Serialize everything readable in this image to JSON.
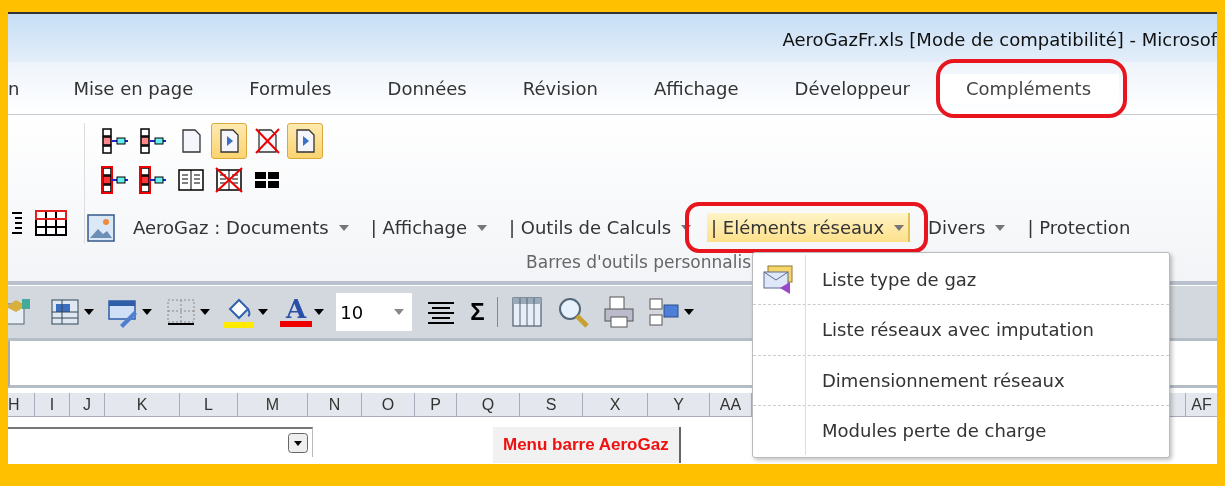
{
  "window": {
    "title": "AeroGazFr.xls  [Mode de compatibilité]  -  Microsof"
  },
  "tabs": [
    {
      "label": "n",
      "selected": false,
      "annotated": false
    },
    {
      "label": "Mise en page",
      "selected": false,
      "annotated": false
    },
    {
      "label": "Formules",
      "selected": false,
      "annotated": false
    },
    {
      "label": "Données",
      "selected": false,
      "annotated": false
    },
    {
      "label": "Révision",
      "selected": false,
      "annotated": false
    },
    {
      "label": "Affichage",
      "selected": false,
      "annotated": false
    },
    {
      "label": "Développeur",
      "selected": false,
      "annotated": false
    },
    {
      "label": "Compléments",
      "selected": true,
      "annotated": true
    }
  ],
  "ribbon": {
    "icon_rows": [
      [
        {
          "kind": "row-left",
          "pressed": false
        },
        {
          "kind": "row-right",
          "pressed": false
        },
        {
          "kind": "page",
          "pressed": false
        },
        {
          "kind": "page-play",
          "pressed": true
        },
        {
          "kind": "page-x",
          "pressed": false
        },
        {
          "kind": "page-play",
          "pressed": true
        }
      ],
      [
        {
          "kind": "col-left",
          "pressed": false
        },
        {
          "kind": "col-right",
          "pressed": false
        },
        {
          "kind": "columns",
          "pressed": false
        },
        {
          "kind": "columns-x",
          "pressed": false
        },
        {
          "kind": "split",
          "pressed": false
        }
      ]
    ],
    "menus": [
      {
        "label": "AeroGaz : Documents",
        "caret": true,
        "open": false,
        "annotated": false
      },
      {
        "label": "| Affichage",
        "caret": true,
        "open": false,
        "annotated": false
      },
      {
        "label": "| Outils de Calculs",
        "caret": true,
        "open": false,
        "annotated": false
      },
      {
        "label": "| Eléments réseaux",
        "caret": true,
        "open": true,
        "annotated": true
      },
      {
        "label": "Divers",
        "caret": true,
        "open": false,
        "annotated": false
      },
      {
        "label": "| Protection",
        "caret": false,
        "open": false,
        "annotated": false
      }
    ],
    "group_label": "Barres d'outils personnalis"
  },
  "dropdown": {
    "items": [
      {
        "label": "Liste type de gaz",
        "kind": "icon"
      },
      {
        "label": "Liste réseaux avec imputation",
        "kind": "plain"
      },
      {
        "label": "Dimensionnement réseaux",
        "kind": "plain"
      },
      {
        "label": "Modules perte de charge",
        "kind": "plain"
      }
    ]
  },
  "toolbar": {
    "items": [
      {
        "kind": "paste"
      },
      {
        "kind": "table",
        "caret": true
      },
      {
        "kind": "format",
        "caret": true
      },
      {
        "kind": "borders",
        "caret": true
      },
      {
        "kind": "fill",
        "caret": true
      },
      {
        "kind": "font-color",
        "glyph": "A",
        "caret": true
      },
      {
        "kind": "size",
        "value": "10"
      },
      {
        "kind": "align"
      },
      {
        "kind": "sum",
        "glyph": "Σ"
      },
      {
        "kind": "sep"
      },
      {
        "kind": "sheet"
      },
      {
        "kind": "zoom"
      },
      {
        "kind": "print"
      },
      {
        "kind": "layout",
        "caret": true
      }
    ]
  },
  "columns": [
    "H",
    "I",
    "J",
    "K",
    "L",
    "M",
    "N",
    "O",
    "P",
    "Q",
    "S",
    "X",
    "Y",
    "AA",
    "AF"
  ],
  "sheet": {
    "macro_button": "Menu barre AeroGaz"
  }
}
